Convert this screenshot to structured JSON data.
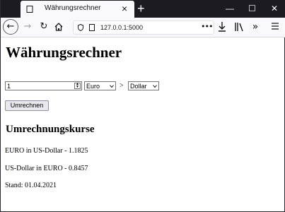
{
  "browser": {
    "tab_title": "Währungsrechner",
    "tab_close": "×",
    "new_tab": "+",
    "url": "127.0.0.1:5000",
    "url_more": "•••",
    "controls": {
      "minimize": "—",
      "maximize": "☐",
      "close": "✕"
    },
    "colors": {
      "titlebar": "#1c1b22",
      "toolbar": "#f9f9fb"
    }
  },
  "page": {
    "heading": "Währungsrechner",
    "amount_value": "1",
    "from_currency": "Euro",
    "arrow": ">",
    "to_currency": "Dollar",
    "convert_button": "Umrechnen",
    "rates_heading": "Umrechnungskurse",
    "rates": [
      "EURO in US-Dollar - 1.1825",
      "US-Dollar in EURO - 0.8457"
    ],
    "as_of": "Stand: 01.04.2021"
  }
}
